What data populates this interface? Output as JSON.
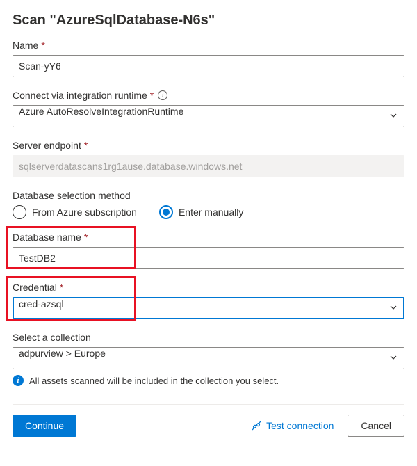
{
  "page_title": "Scan \"AzureSqlDatabase-N6s\"",
  "fields": {
    "name": {
      "label": "Name",
      "value": "Scan-yY6"
    },
    "runtime": {
      "label": "Connect via integration runtime",
      "value": "Azure AutoResolveIntegrationRuntime"
    },
    "endpoint": {
      "label": "Server endpoint",
      "value": "sqlserverdatascans1rg1ause.database.windows.net"
    },
    "db_method": {
      "label": "Database selection method",
      "option_subscription": "From Azure subscription",
      "option_manual": "Enter manually",
      "selected": "manual"
    },
    "db_name": {
      "label": "Database name",
      "value": "TestDB2"
    },
    "credential": {
      "label": "Credential",
      "value": "cred-azsql"
    },
    "collection": {
      "label": "Select a collection",
      "value": "adpurview > Europe"
    }
  },
  "info_message": "All assets scanned will be included in the collection you select.",
  "footer": {
    "continue": "Continue",
    "test_connection": "Test connection",
    "cancel": "Cancel"
  }
}
